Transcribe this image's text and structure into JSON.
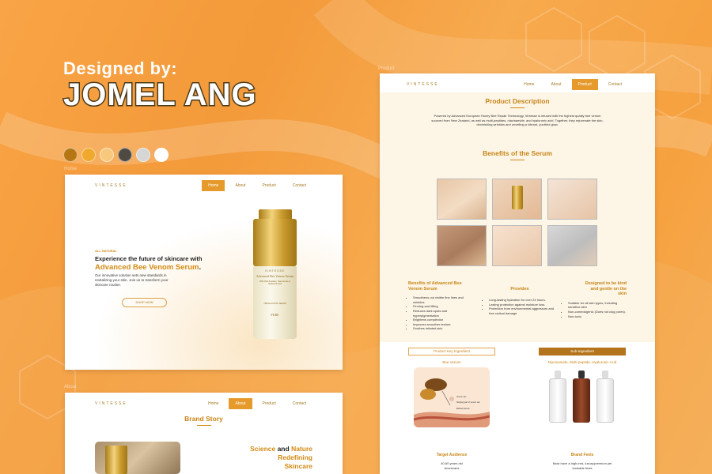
{
  "cover": {
    "designed_by": "Designed by:",
    "designer": "JOMEL ANG",
    "swatches": [
      "#b67613",
      "#f1a92d",
      "#f8c87d",
      "#4f4a42",
      "#d6d6d6",
      "#ffffff"
    ]
  },
  "labels": {
    "home": "Home",
    "about": "About",
    "product": "Product"
  },
  "nav": {
    "logo": "VINTESSE",
    "home": "Home",
    "about": "About",
    "product": "Product",
    "contact": "Contact"
  },
  "home": {
    "eyebrow": "ALL NATURAL",
    "headline": "Experience the future of skincare with",
    "product_name": "Advanced Bee Venom Serum",
    "product_suffix": ".",
    "body": "Our innovative solution sets new standards in revitalizing your skin. Join us to transform your skincare routine.",
    "cta": "SHOP NOW",
    "bottle": {
      "brand": "VINTESSE",
      "name": "Advanced Bee Venom Serum",
      "sub": "With Multi-Peptides, Niacinamide & Hyaluronic Acid",
      "line": "TRIPLE ACTION SERUM",
      "footer": "PURE"
    }
  },
  "about": {
    "title": "Brand Story",
    "line1a": "Science ",
    "line1b": "and ",
    "line1c": "Nature",
    "line2": "Redefining",
    "line3": "Skincare"
  },
  "product": {
    "desc_title": "Product Description",
    "desc": "Powered by Advanced European Honey Bee Repair Technology, Vintesse is infused with the highest quality bee venom sourced from New Zealand, as well as multi-peptides, niacinamide, and hyaluronic acid. Together, they rejuvenate the skin, diminishing wrinkles and unveiling a vibrant, youthful glow.",
    "benefits_title": "Benefits of the Serum",
    "col1_title": "Benefits of Advanced Bee Venom Serum",
    "col1": [
      "Smoothens out visible fine lines and wrinkles",
      "Firming and lifting",
      "Reduces dark spots and hyperpigmentation",
      "Brightens complexion",
      "Improves smoother texture",
      "Soothes irritated skin"
    ],
    "col2_title": "Provides",
    "col2": [
      "Long-lasting hydration for over 24 hours.",
      "Lasting protection against moisture loss.",
      "Protection from environmental aggressors and free radical damage"
    ],
    "col3_title": "Designed to be kind and gentle on the skin",
    "col3": [
      "Suitable for all skin types, including sensitive skin",
      "Non-comedogenic (Does not clog pores).",
      "Non-toxic."
    ],
    "key_ingredient": "Product Key Ingredient",
    "key_name": "Bee Venom",
    "sub_ingredient": "Sub-Ingredient",
    "sub_names": "Niacinamide, Multi-peptide, Hyaluronic Acid",
    "target_title": "Target Audience",
    "target_text": "40-60 years old Americans",
    "feels_title": "Brand Feels",
    "feels_text": "Must have a high-end, luxury/premium yet trustable feels",
    "diagram_labels": [
      "Venom sac",
      "Stinging part of venom sac",
      "Barbed lancets"
    ]
  }
}
